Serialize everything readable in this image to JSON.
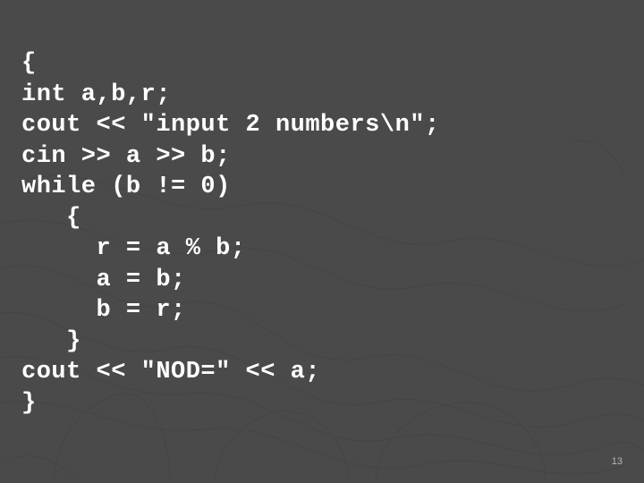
{
  "code": {
    "lines": [
      "{",
      "int a,b,r;",
      "cout << \"input 2 numbers\\n\";",
      "cin >> a >> b;",
      "while (b != 0)",
      "   {",
      "     r = a % b;",
      "     a = b;",
      "     b = r;",
      "   }",
      "cout << \"NOD=\" << a;",
      "}"
    ]
  },
  "page_number": "13",
  "colors": {
    "background": "#4a4a4a",
    "text": "#ffffff",
    "line_art": "#3a3a3a"
  }
}
